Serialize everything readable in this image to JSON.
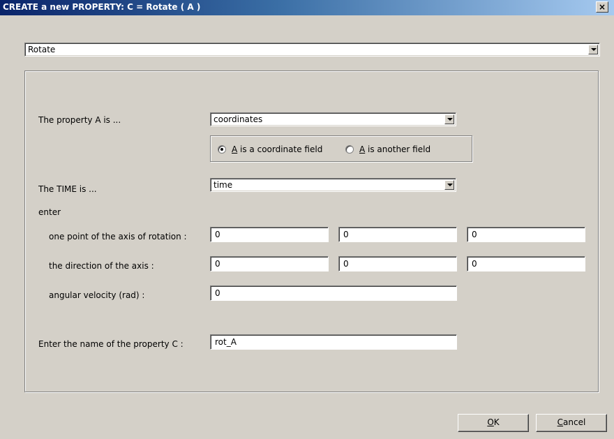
{
  "window": {
    "title": "CREATE a new PROPERTY: C = Rotate ( A )",
    "close_glyph": "×"
  },
  "operation_select": {
    "value": "Rotate"
  },
  "property_a": {
    "label": "The property A is ...",
    "value": "coordinates",
    "radio_coordinate": {
      "accel": "A",
      "rest": " is a coordinate field",
      "checked": true
    },
    "radio_other": {
      "accel": "A",
      "rest": " is another field",
      "checked": false
    }
  },
  "time": {
    "label": "The TIME is ...",
    "value": "time"
  },
  "enter_label": "enter",
  "axis_point": {
    "label": "one point of the axis of rotation :",
    "values": [
      "0",
      "0",
      "0"
    ]
  },
  "axis_direction": {
    "label": "the direction of the axis :",
    "values": [
      "0",
      "0",
      "0"
    ]
  },
  "angular_velocity": {
    "label": "angular velocity (rad) :",
    "value": "0"
  },
  "property_c": {
    "label": "Enter the name of the property C :",
    "value": "rot_A"
  },
  "buttons": {
    "ok": {
      "accel": "O",
      "rest": "K"
    },
    "cancel": {
      "accel": "C",
      "rest": "ancel"
    }
  }
}
